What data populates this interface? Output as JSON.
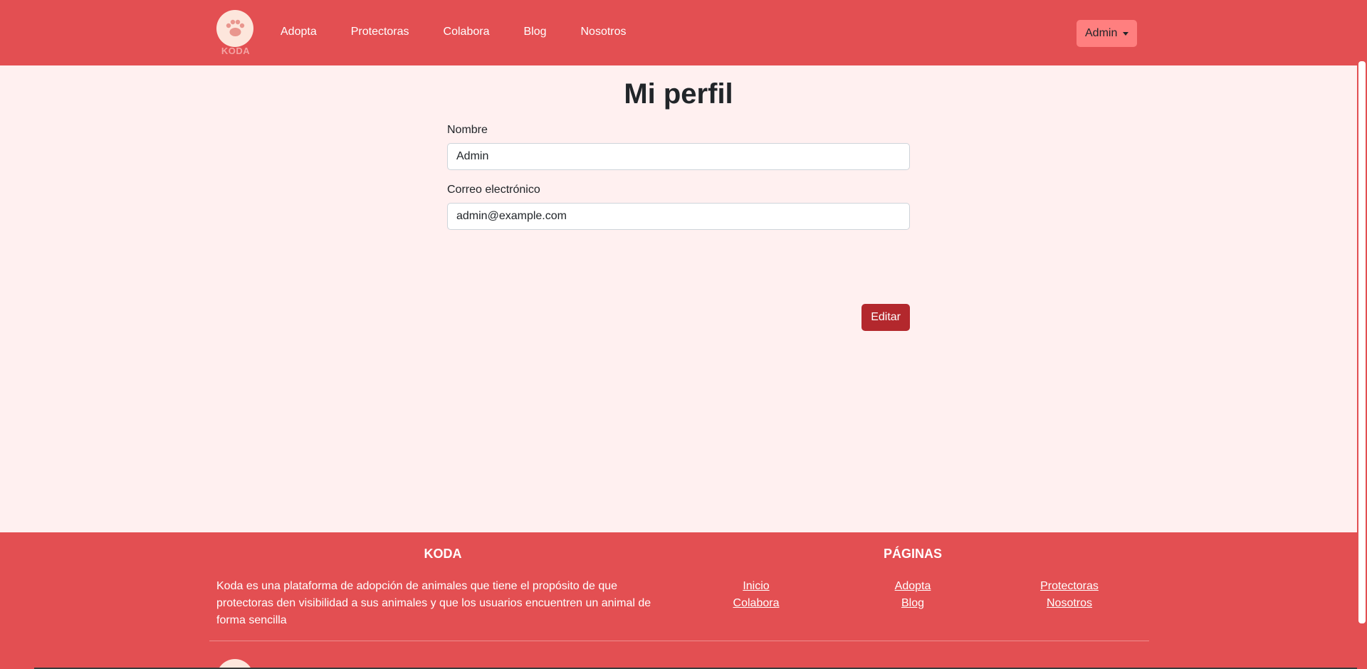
{
  "header": {
    "brand_name": "KODA",
    "nav": [
      "Adopta",
      "Protectoras",
      "Colabora",
      "Blog",
      "Nosotros"
    ],
    "user_menu_label": "Admin"
  },
  "main": {
    "title": "Mi perfil",
    "fields": {
      "name": {
        "label": "Nombre",
        "value": "Admin"
      },
      "email": {
        "label": "Correo electrónico",
        "value": "admin@example.com"
      }
    },
    "edit_label": "Editar"
  },
  "footer": {
    "koda_title": "KODA",
    "description": "Koda es una plataforma de adopción de animales que tiene el propósito de que protectoras den visibilidad a sus animales y que los usuarios encuentren un animal de forma sencilla",
    "pages_title": "PÁGINAS",
    "links": [
      "Inicio",
      "Adopta",
      "Protectoras",
      "Colabora",
      "Blog",
      "Nosotros"
    ]
  },
  "colors": {
    "primary": "#e34f52",
    "background": "#fff0f0",
    "admin_button": "#ff7f7f",
    "edit_button": "#b3282d"
  },
  "icons": {
    "brand_logo": "paw-icon",
    "user_menu": "caret-down-icon"
  }
}
